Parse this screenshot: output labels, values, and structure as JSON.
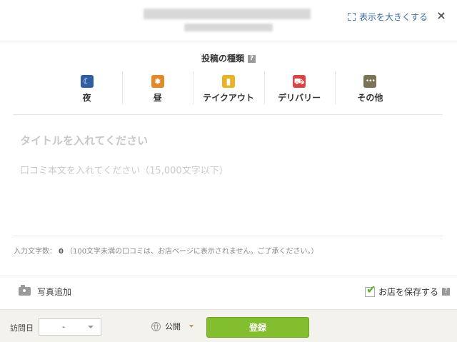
{
  "header": {
    "expand_label": "表示を大きくする",
    "close_symbol": "×"
  },
  "post_type": {
    "title": "投稿の種類",
    "help_symbol": "?",
    "types": [
      {
        "label": "夜",
        "icon": "moon-icon",
        "symbol": "☾",
        "color": "#2e5fa3"
      },
      {
        "label": "昼",
        "icon": "sun-icon",
        "symbol": "✹",
        "color": "#e08a2a"
      },
      {
        "label": "テイクアウト",
        "icon": "takeout-bag-icon",
        "symbol": "▮",
        "color": "#e8b327"
      },
      {
        "label": "デリバリー",
        "icon": "delivery-icon",
        "symbol": "⛟",
        "color": "#d84545"
      },
      {
        "label": "その他",
        "icon": "more-dots-icon",
        "symbol": "•••",
        "color": "#7c7356"
      }
    ]
  },
  "editor": {
    "title_placeholder": "タイトルを入れてください",
    "body_placeholder": "口コミ本文を入れてください（15,000文字以下）",
    "title_value": "",
    "body_value": ""
  },
  "char_count": {
    "label": "入力文字数：",
    "value": "0",
    "note": "（100文字未満の口コミは、お店ページに表示されません。ご了承ください。）"
  },
  "photo": {
    "label": "写真追加",
    "icon": "camera-icon"
  },
  "save_store": {
    "label": "お店を保存する",
    "checked": true,
    "check_symbol": "✔",
    "help_symbol": "?"
  },
  "footer": {
    "visit_label": "訪問日",
    "visit_value": "-",
    "publish_label": "公開",
    "submit_label": "登録"
  },
  "colors": {
    "accent_green": "#82be2e",
    "link_blue": "#3a6a9c"
  }
}
